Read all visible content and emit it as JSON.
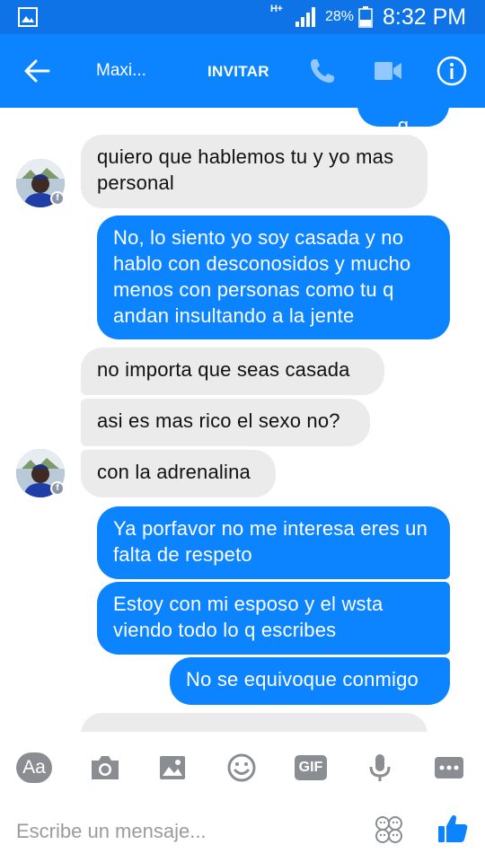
{
  "status_bar": {
    "network": "H+",
    "battery": "28%",
    "time": "8:32 PM"
  },
  "header": {
    "contact_name": "Maxi...",
    "invite_label": "INVITAR"
  },
  "conversation": {
    "partial_top": "Para q",
    "messages": [
      {
        "sender": "contact",
        "text": "quiero que hablemos tu y yo mas personal"
      },
      {
        "sender": "me",
        "text": "No, lo siento yo soy casada y no hablo con desconosidos y mucho menos con personas como tu q andan insultando a la jente"
      },
      {
        "sender": "contact",
        "text": "no importa que seas casada"
      },
      {
        "sender": "contact",
        "text": "asi es mas rico el sexo no?"
      },
      {
        "sender": "contact",
        "text": "con la adrenalina"
      },
      {
        "sender": "me",
        "text": "Ya porfavor no me interesa eres un falta de respeto"
      },
      {
        "sender": "me",
        "text": "Estoy con mi esposo y el wsta viendo todo lo q escribes"
      },
      {
        "sender": "me",
        "text": "No se equivoque conmigo"
      }
    ]
  },
  "composer": {
    "placeholder": "Escribe un mensaje...",
    "toolbar": [
      "text-format-icon",
      "camera-icon",
      "gallery-icon",
      "emoji-icon",
      "gif-icon",
      "microphone-icon",
      "more-icon"
    ],
    "text_format_label": "Aa",
    "gif_label": "GIF"
  },
  "colors": {
    "accent": "#0d84ff",
    "status_bar": "#0d73e6",
    "incoming_bubble": "#ebebeb",
    "toolbar_icon": "#8a8d91"
  }
}
